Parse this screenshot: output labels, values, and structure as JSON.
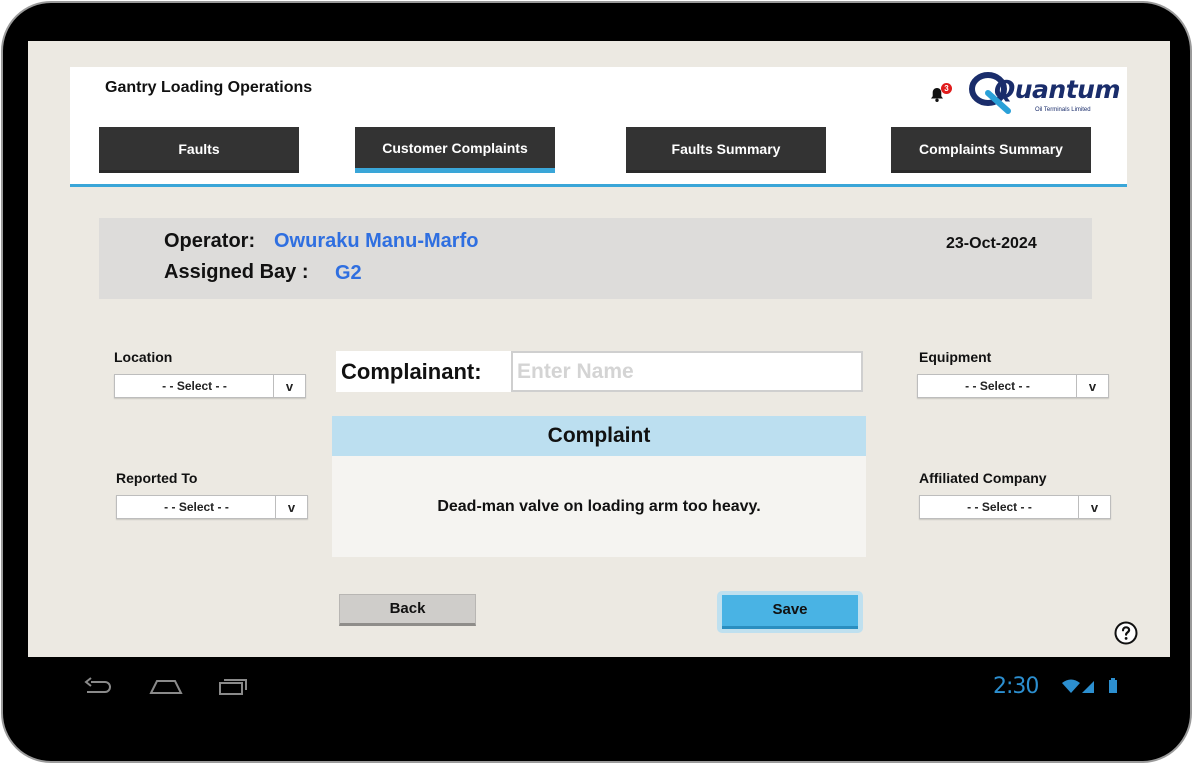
{
  "app": {
    "title": "Gantry Loading Operations",
    "logo_text": "Quantum",
    "logo_subtext": "Oil Terminals Limited",
    "notification_count": "3"
  },
  "tabs": [
    {
      "label": "Faults",
      "active": false
    },
    {
      "label": "Customer Complaints",
      "active": true
    },
    {
      "label": "Faults Summary",
      "active": false
    },
    {
      "label": "Complaints Summary",
      "active": false
    }
  ],
  "info": {
    "operator_label": "Operator:",
    "operator_name": "Owuraku Manu-Marfo",
    "bay_label": "Assigned Bay :",
    "bay_value": "G2",
    "date": "23-Oct-2024"
  },
  "fields": {
    "location": {
      "label": "Location",
      "value": "- - Select  - -",
      "arrow": "v"
    },
    "reported_to": {
      "label": "Reported To",
      "value": "- - Select  - -",
      "arrow": "v"
    },
    "equipment": {
      "label": "Equipment",
      "value": "- - Select  - -",
      "arrow": "v"
    },
    "affiliated_company": {
      "label": "Affiliated Company",
      "value": "- - Select  - -",
      "arrow": "v"
    }
  },
  "complainant": {
    "label": "Complainant:",
    "placeholder": "Enter Name",
    "value": ""
  },
  "complaint": {
    "header": "Complaint",
    "text": "Dead-man valve on loading arm too heavy."
  },
  "buttons": {
    "back": "Back",
    "save": "Save"
  },
  "status_bar": {
    "time": "2:30"
  },
  "colors": {
    "accent": "#3aa6d8",
    "tab_bg": "#333333",
    "blue_text": "#2f6fe0",
    "save_bg": "#49b3e4"
  }
}
